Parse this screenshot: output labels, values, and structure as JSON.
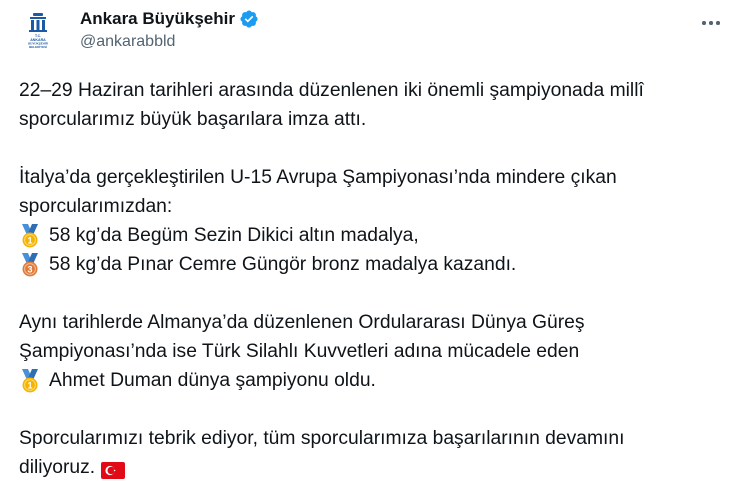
{
  "account": {
    "display_name": "Ankara Büyükşehir",
    "handle": "@ankarabbld",
    "verified": true,
    "logo_text": [
      "T.C.",
      "ANKARA",
      "BÜYÜKŞEHİR",
      "BELEDİYESİ"
    ]
  },
  "post": {
    "paragraphs": [
      {
        "lines": [
          {
            "text": "22–29 Haziran tarihleri arasında düzenlenen iki önemli şampiyonada millî"
          },
          {
            "text": "sporcularımız büyük başarılara imza attı."
          }
        ]
      },
      {
        "lines": [
          {
            "text": "İtalya’da gerçekleştirilen U-15 Avrupa Şampiyonası’nda mindere çıkan"
          },
          {
            "text": "sporcularımızdan:"
          },
          {
            "medal": "gold-medal-icon",
            "text": "58 kg’da Begüm Sezin Dikici altın madalya,"
          },
          {
            "medal": "bronze-medal-icon",
            "text": "58 kg’da Pınar Cemre Güngör bronz madalya kazandı."
          }
        ]
      },
      {
        "lines": [
          {
            "text": "Aynı tarihlerde Almanya’da düzenlenen Ordulararası Dünya Güreş"
          },
          {
            "text": "Şampiyonası’nda ise Türk Silahlı Kuvvetleri adına mücadele eden"
          },
          {
            "medal": "gold-medal-icon",
            "text": "Ahmet Duman dünya şampiyonu oldu."
          }
        ]
      },
      {
        "lines": [
          {
            "text": "Sporcularımızı tebrik ediyor, tüm sporcularımıza başarılarının devamını"
          },
          {
            "text": "diliyoruz.",
            "flag": "turkey-flag-icon"
          }
        ]
      }
    ]
  },
  "colors": {
    "text": "#0f1419",
    "secondary": "#536471",
    "verified": "#1d9bf0",
    "logo_blue": "#1c5aa6",
    "gold": "#f4b400",
    "bronze": "#e07b39",
    "ribbon_blue": "#4a90d9",
    "flag_red": "#e30a17"
  }
}
